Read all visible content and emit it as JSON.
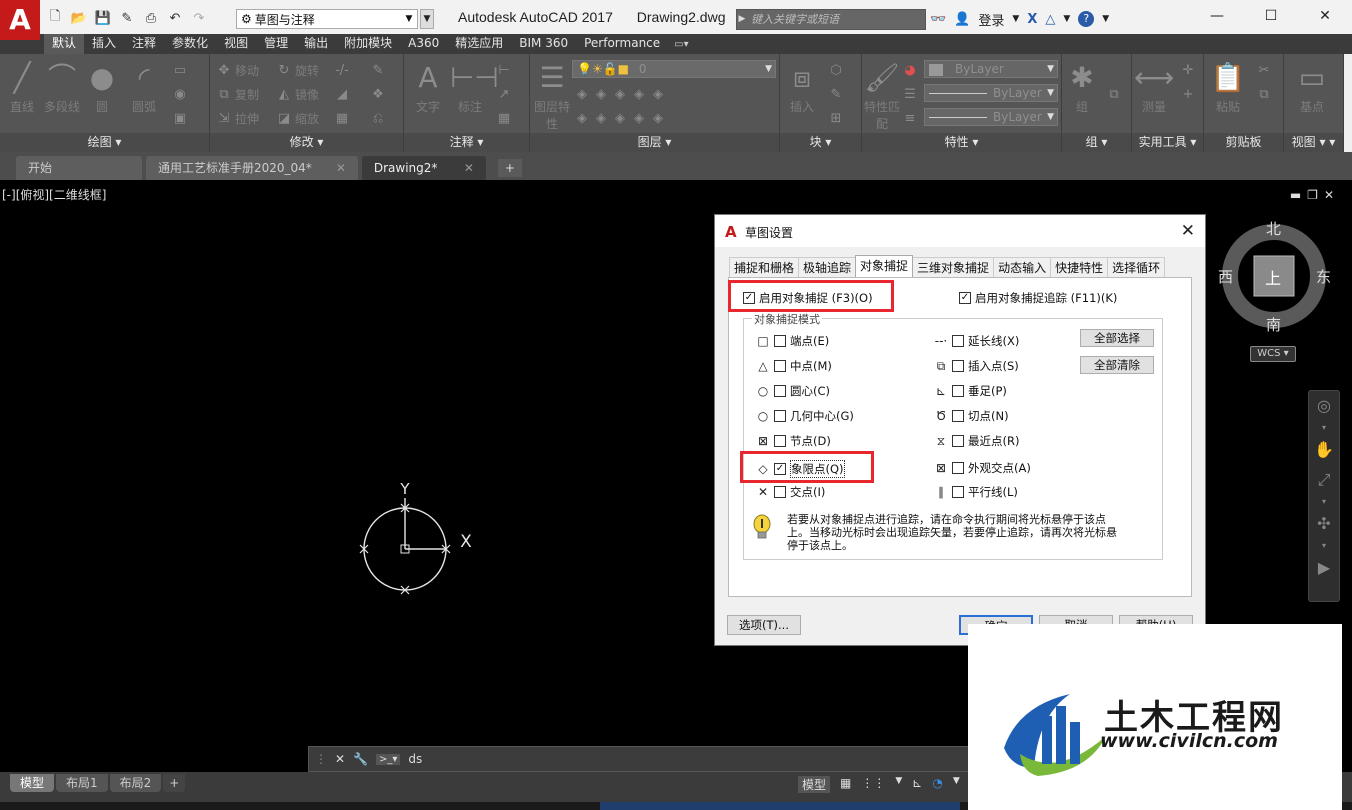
{
  "app": {
    "logo": "A",
    "title": "Autodesk AutoCAD 2017",
    "document": "Drawing2.dwg",
    "workspace": "草图与注释",
    "search_placeholder": "键入关键字或短语",
    "login_label": "登录"
  },
  "ribbon_tabs": [
    "默认",
    "插入",
    "注释",
    "参数化",
    "视图",
    "管理",
    "输出",
    "附加模块",
    "A360",
    "精选应用",
    "BIM 360",
    "Performance"
  ],
  "ribbon_panels": {
    "draw": {
      "title": "绘图",
      "tools": [
        "直线",
        "多段线",
        "圆",
        "圆弧"
      ]
    },
    "modify": {
      "title": "修改",
      "tools": [
        "移动",
        "旋转",
        "复制",
        "镜像",
        "拉伸",
        "缩放"
      ]
    },
    "annotation": {
      "title": "注释",
      "tools": [
        "文字",
        "标注"
      ]
    },
    "layers": {
      "title": "图层",
      "tools": [
        "图层特性"
      ],
      "current_layer": "0"
    },
    "block": {
      "title": "块",
      "tools": [
        "插入"
      ]
    },
    "properties": {
      "title": "特性",
      "tools": [
        "特性匹配"
      ],
      "color": "ByLayer",
      "linetype": "ByLayer",
      "lineweight": "ByLayer"
    },
    "groups": {
      "title": "组",
      "tools": [
        "组"
      ]
    },
    "utilities": {
      "title": "实用工具",
      "tools": [
        "测量"
      ]
    },
    "clipboard": {
      "title": "剪贴板",
      "tools": [
        "粘贴"
      ]
    },
    "view": {
      "title": "视图",
      "tools": [
        "基点"
      ]
    }
  },
  "file_tabs": [
    {
      "label": "开始"
    },
    {
      "label": "通用工艺标准手册2020_04*"
    },
    {
      "label": "Drawing2*"
    }
  ],
  "viewport": {
    "label": "[-][俯视][二维线框]",
    "axis_y": "Y",
    "axis_x": "X"
  },
  "viewcube": {
    "north": "北",
    "south": "南",
    "east": "东",
    "west": "西",
    "face": "上",
    "wcs": "WCS"
  },
  "dialog": {
    "title": "草图设置",
    "tabs": [
      "捕捉和栅格",
      "极轴追踪",
      "对象捕捉",
      "三维对象捕捉",
      "动态输入",
      "快捷特性",
      "选择循环"
    ],
    "active_tab": "对象捕捉",
    "enable_osnap": "启用对象捕捉 (F3)(O)",
    "enable_tracking": "启用对象捕捉追踪 (F11)(K)",
    "group_legend": "对象捕捉模式",
    "left_modes": [
      {
        "symbol": "□",
        "label": "端点(E)",
        "checked": false
      },
      {
        "symbol": "△",
        "label": "中点(M)",
        "checked": false
      },
      {
        "symbol": "○",
        "label": "圆心(C)",
        "checked": false
      },
      {
        "symbol": "○",
        "label": "几何中心(G)",
        "checked": false
      },
      {
        "symbol": "⊠",
        "label": "节点(D)",
        "checked": false
      },
      {
        "symbol": "◇",
        "label": "象限点(Q)",
        "checked": true
      },
      {
        "symbol": "✕",
        "label": "交点(I)",
        "checked": false
      }
    ],
    "right_modes": [
      {
        "symbol": "--·",
        "label": "延长线(X)",
        "checked": false
      },
      {
        "symbol": "⧉",
        "label": "插入点(S)",
        "checked": false
      },
      {
        "symbol": "⊾",
        "label": "垂足(P)",
        "checked": false
      },
      {
        "symbol": "Ծ",
        "label": "切点(N)",
        "checked": false
      },
      {
        "symbol": "⧖",
        "label": "最近点(R)",
        "checked": false
      },
      {
        "symbol": "⊠",
        "label": "外观交点(A)",
        "checked": false
      },
      {
        "symbol": "∥",
        "label": "平行线(L)",
        "checked": false
      }
    ],
    "select_all": "全部选择",
    "clear_all": "全部清除",
    "tip": "若要从对象捕捉点进行追踪，请在命令执行期间将光标悬停于该点上。当移动光标时会出现追踪矢量，若要停止追踪，请再次将光标悬停于该点上。",
    "options_button": "选项(T)...",
    "ok_button": "确定",
    "cancel_button": "取消",
    "help_button": "帮助(H)"
  },
  "command_line": {
    "text": "ds"
  },
  "layout_tabs": [
    "模型",
    "布局1",
    "布局2"
  ],
  "status": {
    "model": "模型"
  },
  "watermark": {
    "title": "土木工程网",
    "url": "www.civilcn.com"
  }
}
